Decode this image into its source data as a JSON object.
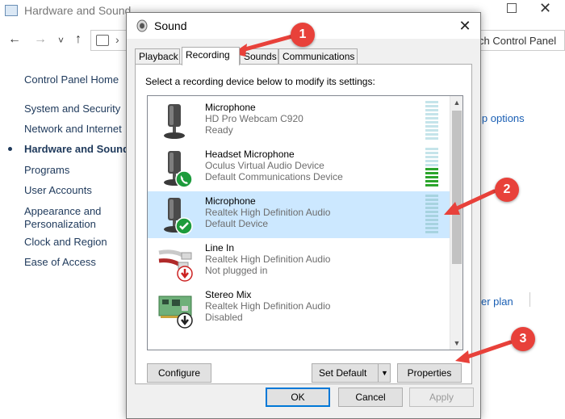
{
  "control_panel": {
    "title": "Hardware and Sound",
    "search_text": "ch Control Panel",
    "nav": {
      "back": "←",
      "forward": "→",
      "recent": "˅",
      "up": "↑",
      "chevron": "›"
    },
    "sidebar": [
      {
        "label": "Control Panel Home"
      },
      {
        "label": "System and Security"
      },
      {
        "label": "Network and Internet"
      },
      {
        "label": "Hardware and Sound",
        "active": true
      },
      {
        "label": "Programs"
      },
      {
        "label": "User Accounts"
      },
      {
        "label": "Appearance and"
      },
      {
        "label": "Personalization"
      },
      {
        "label": "Clock and Region"
      },
      {
        "label": "Ease of Access"
      }
    ],
    "right_links": [
      {
        "label": "ip options"
      },
      {
        "label": "er plan"
      }
    ],
    "window_controls": {
      "maximize": "□",
      "close": "✕"
    }
  },
  "dialog": {
    "title": "Sound",
    "close_label": "✕",
    "tabs": [
      {
        "label": "Playback"
      },
      {
        "label": "Recording",
        "selected": true
      },
      {
        "label": "Sounds"
      },
      {
        "label": "Communications"
      }
    ],
    "instruction": "Select a recording device below to modify its settings:",
    "devices": [
      {
        "name": "Microphone",
        "line1": "HD Pro Webcam C920",
        "line2": "Ready",
        "icon": "microphone-icon",
        "badge": "none",
        "level": 0.0
      },
      {
        "name": "Headset Microphone",
        "line1": "Oculus Virtual Audio Device",
        "line2": "Default Communications Device",
        "icon": "microphone-icon",
        "badge": "phone-badge",
        "level": 0.5
      },
      {
        "name": "Microphone",
        "line1": "Realtek High Definition Audio",
        "line2": "Default Device",
        "icon": "microphone-icon",
        "badge": "check-badge",
        "level": 0.0,
        "selected": true
      },
      {
        "name": "Line In",
        "line1": "Realtek High Definition Audio",
        "line2": "Not plugged in",
        "icon": "audio-cable-icon",
        "badge": "red-down-arrow-badge"
      },
      {
        "name": "Stereo Mix",
        "line1": "Realtek High Definition Audio",
        "line2": "Disabled",
        "icon": "sound-card-icon",
        "badge": "black-down-arrow-badge"
      }
    ],
    "buttons": {
      "configure": "Configure",
      "set_default": "Set Default",
      "properties": "Properties",
      "ok": "OK",
      "cancel": "Cancel",
      "apply": "Apply"
    },
    "colors": {
      "selection": "#cce8ff",
      "accent": "#0078d7",
      "meter_on": "#2ca52c",
      "meter_off": "#c5e4ea"
    }
  },
  "annotations": [
    {
      "number": "1",
      "target": "Recording tab"
    },
    {
      "number": "2",
      "target": "Microphone - Realtek High Definition Audio"
    },
    {
      "number": "3",
      "target": "Properties button"
    }
  ],
  "annotation_color": "#e8413a"
}
